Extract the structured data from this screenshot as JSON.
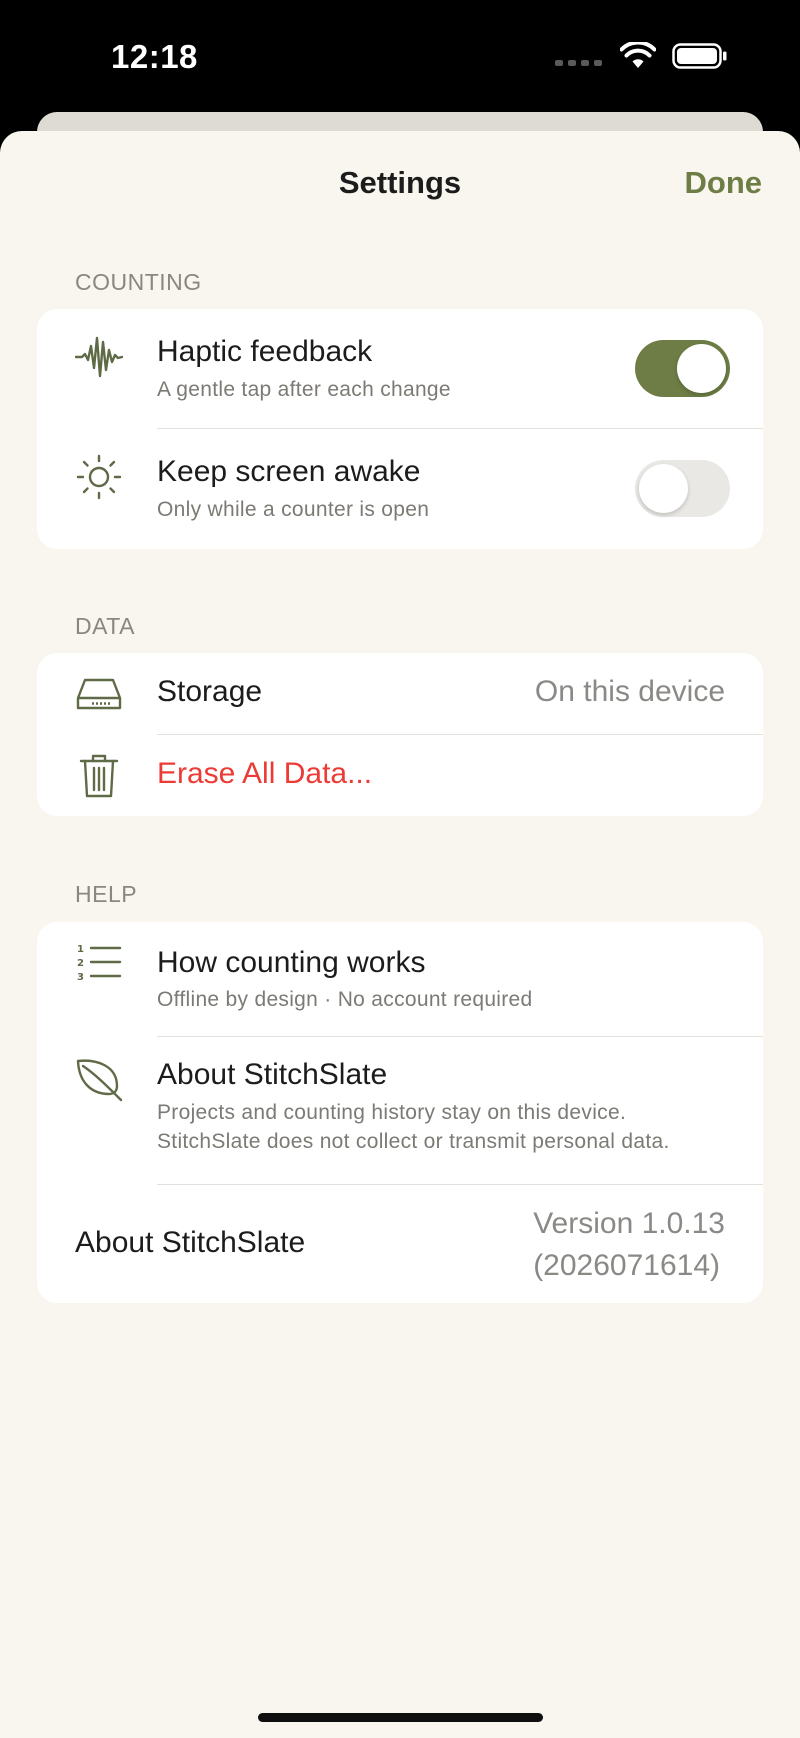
{
  "status_bar": {
    "time": "12:18"
  },
  "nav": {
    "title": "Settings",
    "done_label": "Done"
  },
  "sections": {
    "counting": {
      "header": "COUNTING",
      "haptic": {
        "title": "Haptic feedback",
        "subtitle": "A gentle tap after each change",
        "enabled": true,
        "icon": "waveform-icon"
      },
      "awake": {
        "title": "Keep screen awake",
        "subtitle": "Only while a counter is open",
        "enabled": false,
        "icon": "sun-icon"
      }
    },
    "data": {
      "header": "DATA",
      "storage": {
        "title": "Storage",
        "value": "On this device",
        "icon": "drive-icon"
      },
      "erase": {
        "title": "Erase All Data...",
        "icon": "trash-icon"
      }
    },
    "help": {
      "header": "HELP",
      "how": {
        "title": "How counting works",
        "subtitle": "Offline by design · No account required",
        "icon": "numbered-list-icon"
      },
      "about": {
        "title": "About StitchSlate",
        "subtitle_line1": "Projects and counting history stay on this device.",
        "subtitle_line2": "StitchSlate does not collect or transmit personal data.",
        "icon": "leaf-icon"
      },
      "version_row": {
        "title": "About StitchSlate",
        "version_line1": "Version 1.0.13",
        "version_line2": "(2026071614)"
      }
    }
  },
  "colors": {
    "accent": "#6d7d45",
    "destructive": "#ec3b35",
    "background": "#f8f6ef",
    "card": "#ffffff"
  }
}
